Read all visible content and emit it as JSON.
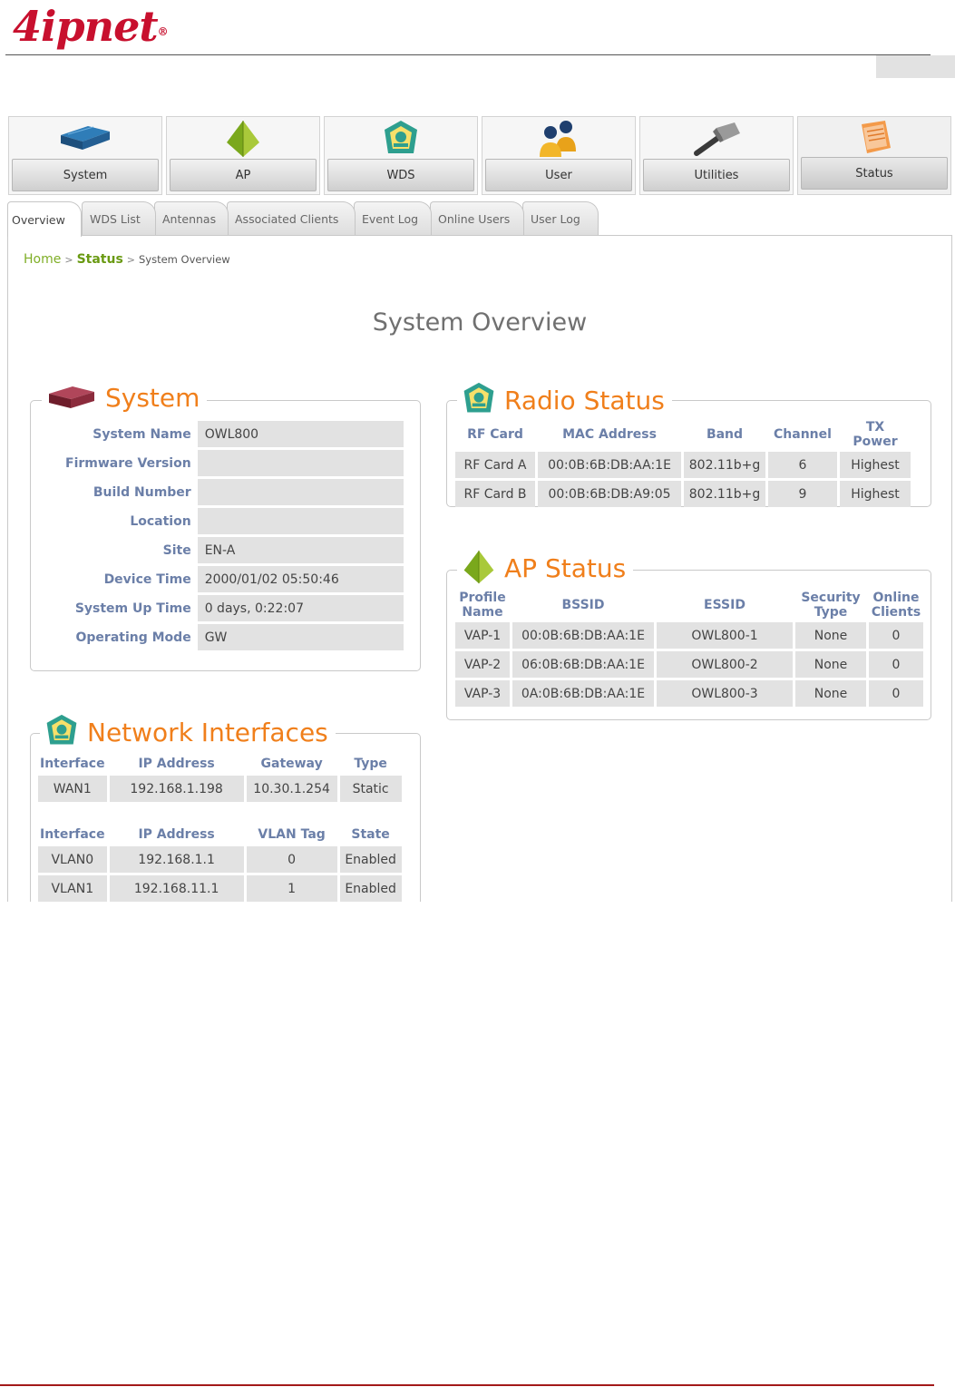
{
  "brand": {
    "logo_text": "4ipnet",
    "logo_mark": "®"
  },
  "menu": [
    {
      "label": "System",
      "icon": "network-device-icon"
    },
    {
      "label": "AP",
      "icon": "ap-pyramid-icon"
    },
    {
      "label": "WDS",
      "icon": "wds-emblem-icon"
    },
    {
      "label": "User",
      "icon": "users-icon"
    },
    {
      "label": "Utilities",
      "icon": "hammer-icon"
    },
    {
      "label": "Status",
      "icon": "notepad-icon"
    }
  ],
  "active_menu": "Status",
  "tabs": [
    "Overview",
    "WDS List",
    "Antennas",
    "Associated Clients",
    "Event Log",
    "Online Users",
    "User Log"
  ],
  "active_tab": "Overview",
  "breadcrumb": {
    "home": "Home",
    "section": "Status",
    "sep": ">",
    "current": "System Overview"
  },
  "page_title": "System Overview",
  "system": {
    "title": "System",
    "fields": [
      {
        "label": "System Name",
        "value": "OWL800"
      },
      {
        "label": "Firmware Version",
        "value": ""
      },
      {
        "label": "Build Number",
        "value": ""
      },
      {
        "label": "Location",
        "value": ""
      },
      {
        "label": "Site",
        "value": "EN-A"
      },
      {
        "label": "Device Time",
        "value": "2000/01/02 05:50:46"
      },
      {
        "label": "System Up Time",
        "value": "0 days, 0:22:07"
      },
      {
        "label": "Operating Mode",
        "value": "GW"
      }
    ]
  },
  "radio": {
    "title": "Radio Status",
    "headers": [
      "RF Card",
      "MAC Address",
      "Band",
      "Channel",
      "TX Power"
    ],
    "rows": [
      [
        "RF Card A",
        "00:0B:6B:DB:AA:1E",
        "802.11b+g",
        "6",
        "Highest"
      ],
      [
        "RF Card B",
        "00:0B:6B:DB:A9:05",
        "802.11b+g",
        "9",
        "Highest"
      ]
    ]
  },
  "ap": {
    "title": "AP Status",
    "headers": [
      [
        "Profile",
        "Name"
      ],
      [
        "BSSID"
      ],
      [
        "ESSID"
      ],
      [
        "Security",
        "Type"
      ],
      [
        "Online",
        "Clients"
      ]
    ],
    "rows": [
      [
        "VAP-1",
        "00:0B:6B:DB:AA:1E",
        "OWL800-1",
        "None",
        "0"
      ],
      [
        "VAP-2",
        "06:0B:6B:DB:AA:1E",
        "OWL800-2",
        "None",
        "0"
      ],
      [
        "VAP-3",
        "0A:0B:6B:DB:AA:1E",
        "OWL800-3",
        "None",
        "0"
      ]
    ]
  },
  "network": {
    "title": "Network Interfaces",
    "wan_headers": [
      "Interface",
      "IP Address",
      "Gateway",
      "Type"
    ],
    "wan_rows": [
      [
        "WAN1",
        "192.168.1.198",
        "10.30.1.254",
        "Static"
      ]
    ],
    "vlan_headers": [
      "Interface",
      "IP Address",
      "VLAN Tag",
      "State"
    ],
    "vlan_rows": [
      [
        "VLAN0",
        "192.168.1.1",
        "0",
        "Enabled"
      ],
      [
        "VLAN1",
        "192.168.11.1",
        "1",
        "Enabled"
      ]
    ]
  },
  "colors": {
    "brand_red": "#c8102e",
    "legend_orange": "#f07f1b",
    "label_blue": "#6b7fa8",
    "breadcrumb_green": "#6a9a13"
  }
}
